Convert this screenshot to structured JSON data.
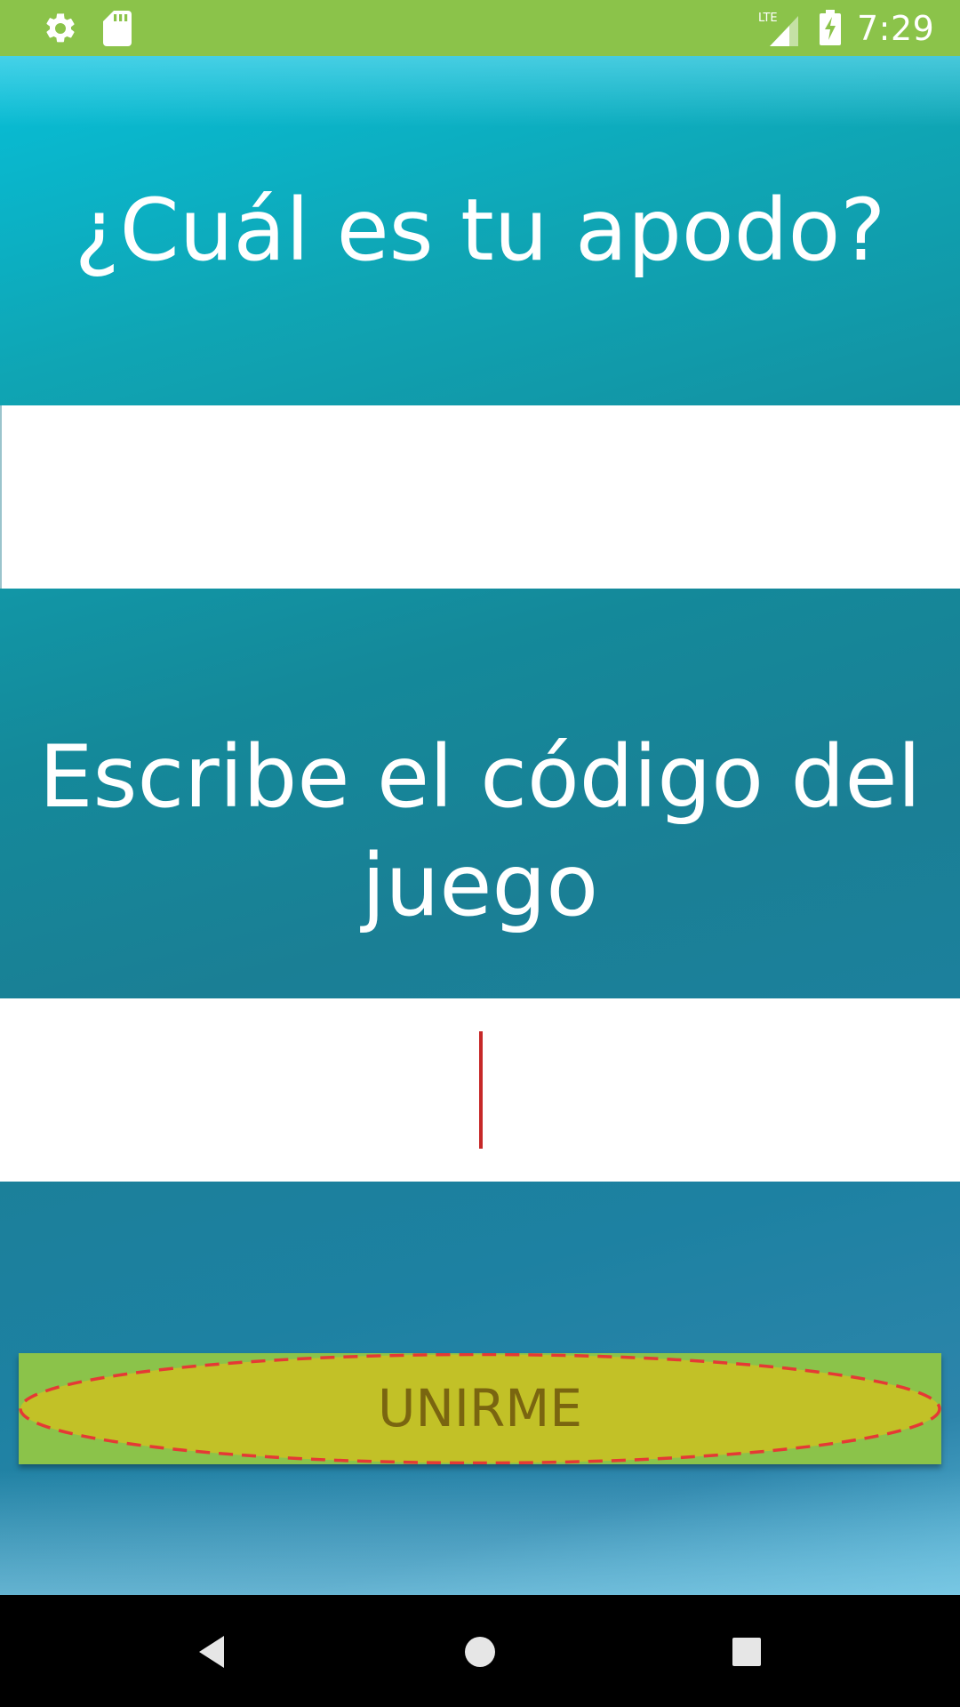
{
  "status_bar": {
    "time": "7:29",
    "network_label": "LTE",
    "icons": [
      "gear-icon",
      "sd-card-icon",
      "signal-icon",
      "battery-charging-icon"
    ]
  },
  "form": {
    "nickname_question": "¿Cuál es tu apodo?",
    "nickname_value": "",
    "code_question": "Escribe el código del juego",
    "code_value": "",
    "join_label": "UNIRME"
  },
  "nav_bar": {
    "icons": [
      "back-icon",
      "home-icon",
      "recents-icon"
    ]
  },
  "colors": {
    "status_bar": "#8bc34a",
    "button_bg": "#8bc34a",
    "button_oval_fill": "#c2c127",
    "button_oval_border": "#e53935",
    "button_text": "#7a6510",
    "caret": "#c62828"
  }
}
